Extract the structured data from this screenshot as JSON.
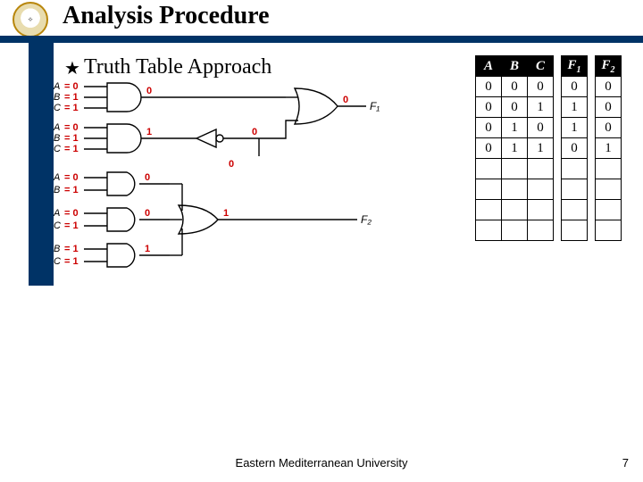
{
  "header": {
    "title": "Analysis Procedure",
    "subtitle": "Truth Table Approach"
  },
  "circuit": {
    "gates": [
      {
        "inputs": [
          {
            "name": "A",
            "val": "= 0"
          },
          {
            "name": "B",
            "val": "= 1"
          },
          {
            "name": "C",
            "val": "= 1"
          }
        ],
        "out_label": "0"
      },
      {
        "inputs": [
          {
            "name": "A",
            "val": "= 0"
          },
          {
            "name": "B",
            "val": "= 1"
          },
          {
            "name": "C",
            "val": "= 1"
          }
        ],
        "out_label": "1"
      },
      {
        "inputs": [
          {
            "name": "A",
            "val": "= 0"
          },
          {
            "name": "B",
            "val": "= 1"
          }
        ],
        "out_label": "0"
      },
      {
        "inputs": [
          {
            "name": "A",
            "val": "= 0"
          },
          {
            "name": "C",
            "val": "= 1"
          }
        ],
        "out_label": "0"
      },
      {
        "inputs": [
          {
            "name": "B",
            "val": "= 1"
          },
          {
            "name": "C",
            "val": "= 1"
          }
        ],
        "out_label": "1"
      }
    ],
    "mid": {
      "node_after_inverter": "0",
      "or3_out_near_F1": "0",
      "and_input_after_inv": "0",
      "or3_bottom_input": "1",
      "F1_label": "F₁",
      "F2_label": "F₂"
    }
  },
  "table": {
    "headers_left": [
      "A",
      "B",
      "C"
    ],
    "headers_right": [
      "F1",
      "F2"
    ],
    "rows": [
      {
        "abc": [
          "0",
          "0",
          "0"
        ],
        "f": [
          "0",
          "0"
        ]
      },
      {
        "abc": [
          "0",
          "0",
          "1"
        ],
        "f": [
          "1",
          "0"
        ]
      },
      {
        "abc": [
          "0",
          "1",
          "0"
        ],
        "f": [
          "1",
          "0"
        ]
      },
      {
        "abc": [
          "0",
          "1",
          "1"
        ],
        "f": [
          "0",
          "1"
        ]
      },
      {
        "abc": [
          "",
          "",
          ""
        ],
        "f": [
          "",
          ""
        ]
      },
      {
        "abc": [
          "",
          "",
          ""
        ],
        "f": [
          "",
          ""
        ]
      },
      {
        "abc": [
          "",
          "",
          ""
        ],
        "f": [
          "",
          ""
        ]
      },
      {
        "abc": [
          "",
          "",
          ""
        ],
        "f": [
          "",
          ""
        ]
      }
    ]
  },
  "footer": {
    "text": "Eastern Mediterranean University",
    "page": "7"
  }
}
